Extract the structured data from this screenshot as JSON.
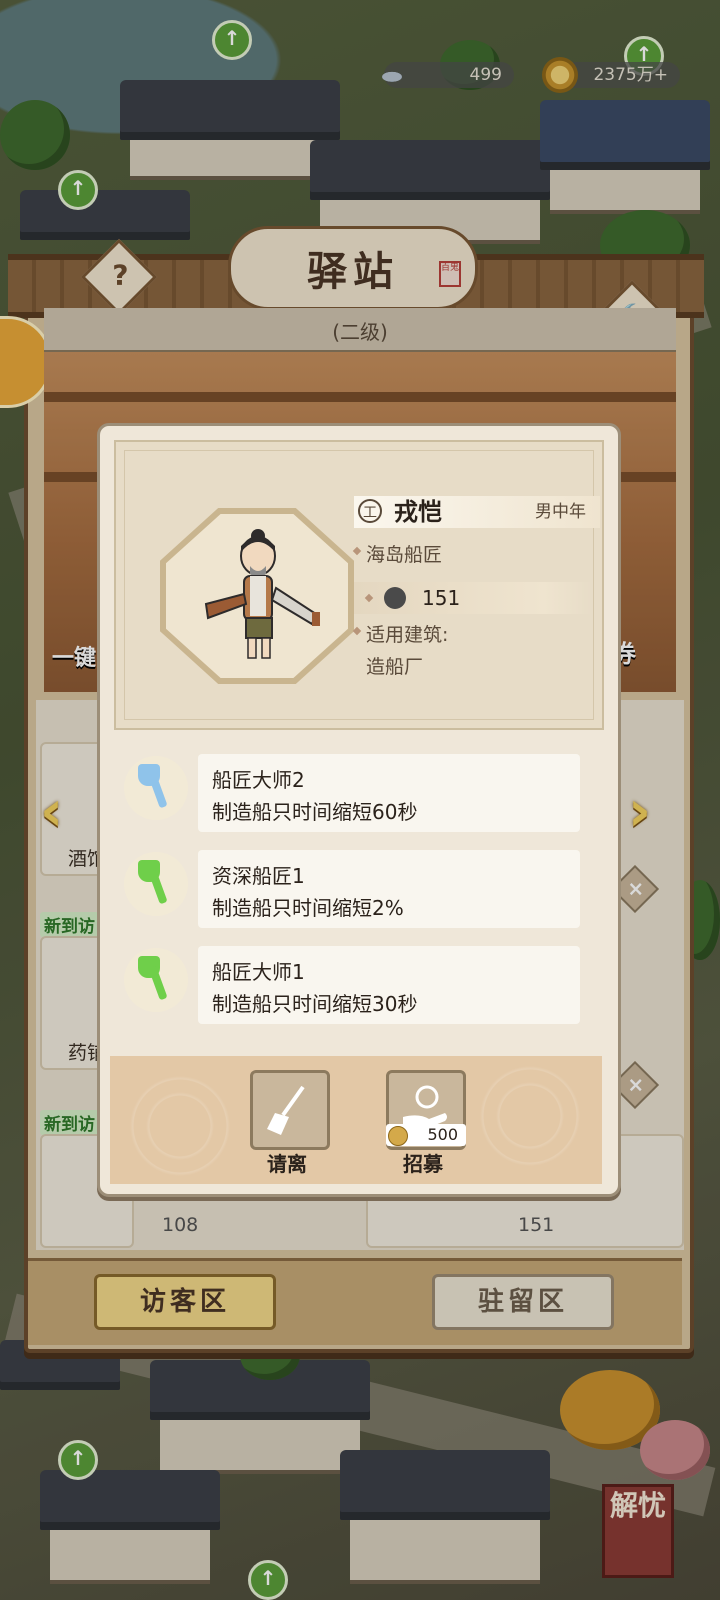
{
  "resources": {
    "silver": "499",
    "coins": "2375万+"
  },
  "building": {
    "title": "驿站",
    "seal_text": "百鬼",
    "level": "(二级)",
    "help_symbol": "?",
    "hammer_symbol": "🔨"
  },
  "background_list": {
    "left_partial_button": "一键",
    "right_partial_button": "券",
    "cards": [
      {
        "name": "酒馆",
        "new_tag": ""
      },
      {
        "name": "药铺",
        "new_tag": "新到访"
      },
      {
        "name": "",
        "new_tag": "新到访"
      }
    ],
    "right_card_value": "151",
    "left_card_value": "108"
  },
  "tabs": {
    "visitor": "访客区",
    "stay": "驻留区"
  },
  "character": {
    "type_icon": "工",
    "name": "戎恺",
    "age_group": "男中年",
    "profession": "海岛船匠",
    "ability_value": "151",
    "suitable_label": "适用建筑:",
    "suitable_building": "造船厂"
  },
  "skills": [
    {
      "title": "船匠大师2",
      "desc": "制造船只时间缩短60秒",
      "icon": "axe-blue-icon",
      "color": "#8fc3ea"
    },
    {
      "title": "资深船匠1",
      "desc": "制造船只时间缩短2%",
      "icon": "axe-green-icon",
      "color": "#6fcf4a"
    },
    {
      "title": "船匠大师1",
      "desc": "制造船只时间缩短30秒",
      "icon": "axe-green-icon",
      "color": "#6fcf4a"
    }
  ],
  "actions": {
    "dismiss": "请离",
    "recruit": "招募",
    "recruit_cost": "500"
  },
  "unlock_button": "解忧"
}
